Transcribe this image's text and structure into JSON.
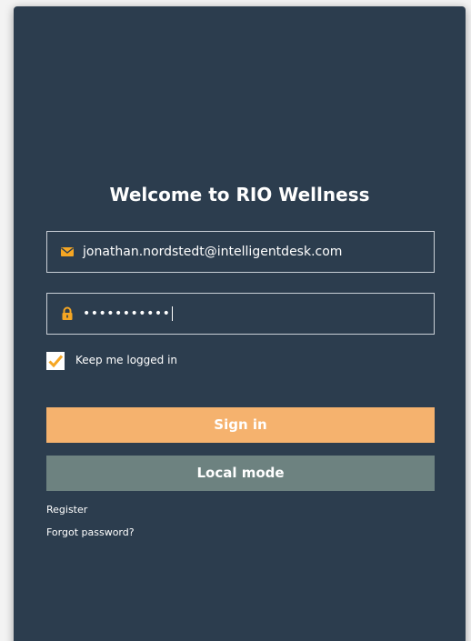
{
  "login": {
    "title": "Welcome to RIO Wellness",
    "email": {
      "value": "jonathan.nordstedt@intelligentdesk.com",
      "icon": "envelope-icon"
    },
    "password": {
      "masked_value": "•••••••••••",
      "icon": "lock-icon"
    },
    "remember": {
      "label": "Keep me logged in",
      "checked": true
    },
    "sign_in_label": "Sign in",
    "local_mode_label": "Local mode",
    "register_link": "Register",
    "forgot_link": "Forgot password?"
  },
  "colors": {
    "panel": "#2c3d4e",
    "accent": "#f5b26e",
    "local_button": "#6d8280",
    "icon": "#f5a623"
  }
}
